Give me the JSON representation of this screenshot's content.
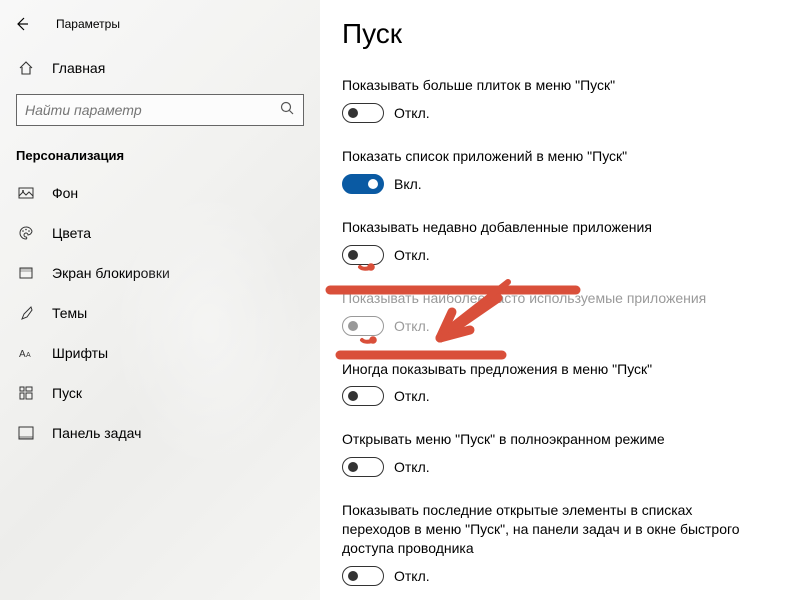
{
  "header": {
    "title": "Параметры"
  },
  "home": {
    "label": "Главная"
  },
  "search": {
    "placeholder": "Найти параметр"
  },
  "section": {
    "label": "Персонализация"
  },
  "nav": {
    "items": [
      {
        "label": "Фон"
      },
      {
        "label": "Цвета"
      },
      {
        "label": "Экран блокировки"
      },
      {
        "label": "Темы"
      },
      {
        "label": "Шрифты"
      },
      {
        "label": "Пуск"
      },
      {
        "label": "Панель задач"
      }
    ]
  },
  "page": {
    "title": "Пуск"
  },
  "toggle_states": {
    "on_label": "Вкл.",
    "off_label": "Откл."
  },
  "settings": [
    {
      "label": "Показывать больше плиток в меню \"Пуск\"",
      "on": false,
      "disabled": false
    },
    {
      "label": "Показать список приложений в меню \"Пуск\"",
      "on": true,
      "disabled": false
    },
    {
      "label": "Показывать недавно добавленные приложения",
      "on": false,
      "disabled": false
    },
    {
      "label": "Показывать наиболее часто используемые приложения",
      "on": false,
      "disabled": true
    },
    {
      "label": "Иногда показывать предложения в меню \"Пуск\"",
      "on": false,
      "disabled": false
    },
    {
      "label": "Открывать меню \"Пуск\" в полноэкранном режиме",
      "on": false,
      "disabled": false
    },
    {
      "label": "Показывать последние открытые элементы в списках переходов в меню \"Пуск\", на панели задач и в окне быстрого доступа проводника",
      "on": false,
      "disabled": false
    }
  ],
  "colors": {
    "accent": "#0a5aa3",
    "annotation": "#d94f3a"
  }
}
